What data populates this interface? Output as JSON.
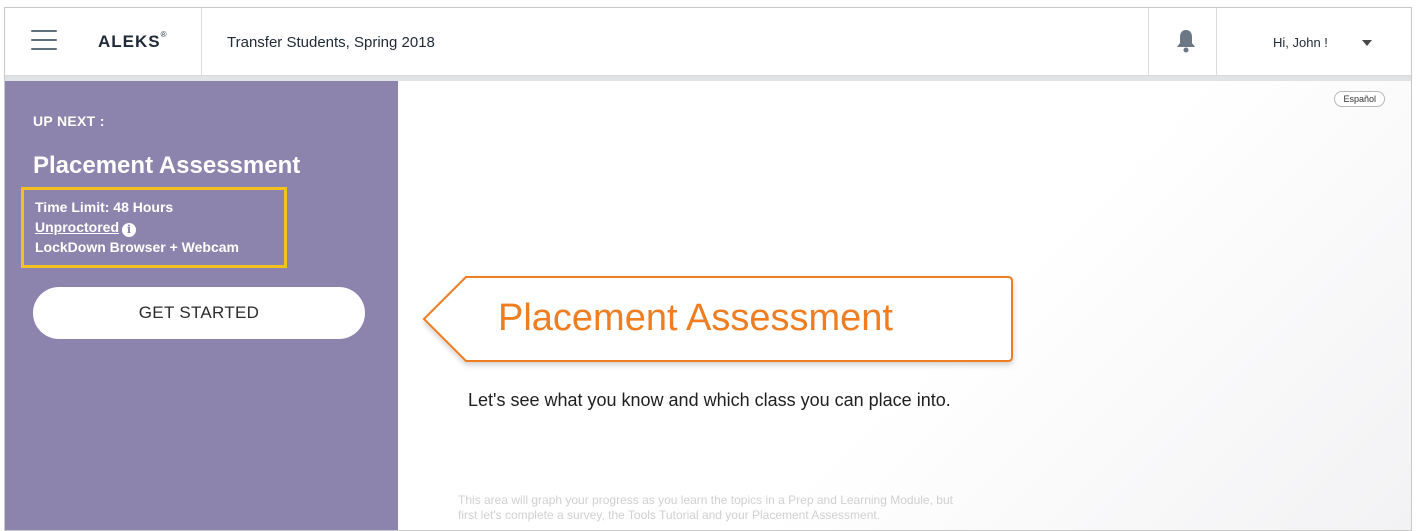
{
  "header": {
    "logo": "ALEKS",
    "logo_mark": "®",
    "class_title": "Transfer Students, Spring 2018",
    "greeting": "Hi, John !"
  },
  "sidebar": {
    "up_next": "UP NEXT :",
    "title": "Placement Assessment",
    "time_limit": "Time Limit: 48 Hours",
    "proctor_status": "Unproctored",
    "browser_requirement": "LockDown Browser + Webcam",
    "start_button": "GET STARTED"
  },
  "main": {
    "language_toggle": "Español",
    "banner_title": "Placement Assessment",
    "description": "Let's see what you know and which class you can place into.",
    "faint_text": "This area will graph your progress as you learn the topics in a Prep and Learning Module, but first let's complete a survey, the Tools Tutorial and your Placement Assessment."
  },
  "colors": {
    "sidebar_bg": "#8c84ac",
    "highlight_border": "#f3c122",
    "accent_orange": "#ef7d22"
  },
  "icons": {
    "menu": "hamburger-menu-icon",
    "bell": "bell-icon",
    "caret": "chevron-down-icon",
    "info": "info-icon"
  }
}
